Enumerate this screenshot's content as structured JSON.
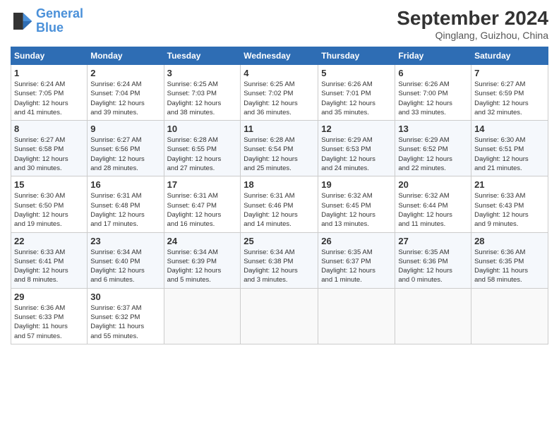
{
  "header": {
    "logo_line1": "General",
    "logo_line2": "Blue",
    "month_year": "September 2024",
    "location": "Qinglang, Guizhou, China"
  },
  "weekdays": [
    "Sunday",
    "Monday",
    "Tuesday",
    "Wednesday",
    "Thursday",
    "Friday",
    "Saturday"
  ],
  "weeks": [
    [
      {
        "day": "1",
        "info": "Sunrise: 6:24 AM\nSunset: 7:05 PM\nDaylight: 12 hours\nand 41 minutes."
      },
      {
        "day": "2",
        "info": "Sunrise: 6:24 AM\nSunset: 7:04 PM\nDaylight: 12 hours\nand 39 minutes."
      },
      {
        "day": "3",
        "info": "Sunrise: 6:25 AM\nSunset: 7:03 PM\nDaylight: 12 hours\nand 38 minutes."
      },
      {
        "day": "4",
        "info": "Sunrise: 6:25 AM\nSunset: 7:02 PM\nDaylight: 12 hours\nand 36 minutes."
      },
      {
        "day": "5",
        "info": "Sunrise: 6:26 AM\nSunset: 7:01 PM\nDaylight: 12 hours\nand 35 minutes."
      },
      {
        "day": "6",
        "info": "Sunrise: 6:26 AM\nSunset: 7:00 PM\nDaylight: 12 hours\nand 33 minutes."
      },
      {
        "day": "7",
        "info": "Sunrise: 6:27 AM\nSunset: 6:59 PM\nDaylight: 12 hours\nand 32 minutes."
      }
    ],
    [
      {
        "day": "8",
        "info": "Sunrise: 6:27 AM\nSunset: 6:58 PM\nDaylight: 12 hours\nand 30 minutes."
      },
      {
        "day": "9",
        "info": "Sunrise: 6:27 AM\nSunset: 6:56 PM\nDaylight: 12 hours\nand 28 minutes."
      },
      {
        "day": "10",
        "info": "Sunrise: 6:28 AM\nSunset: 6:55 PM\nDaylight: 12 hours\nand 27 minutes."
      },
      {
        "day": "11",
        "info": "Sunrise: 6:28 AM\nSunset: 6:54 PM\nDaylight: 12 hours\nand 25 minutes."
      },
      {
        "day": "12",
        "info": "Sunrise: 6:29 AM\nSunset: 6:53 PM\nDaylight: 12 hours\nand 24 minutes."
      },
      {
        "day": "13",
        "info": "Sunrise: 6:29 AM\nSunset: 6:52 PM\nDaylight: 12 hours\nand 22 minutes."
      },
      {
        "day": "14",
        "info": "Sunrise: 6:30 AM\nSunset: 6:51 PM\nDaylight: 12 hours\nand 21 minutes."
      }
    ],
    [
      {
        "day": "15",
        "info": "Sunrise: 6:30 AM\nSunset: 6:50 PM\nDaylight: 12 hours\nand 19 minutes."
      },
      {
        "day": "16",
        "info": "Sunrise: 6:31 AM\nSunset: 6:48 PM\nDaylight: 12 hours\nand 17 minutes."
      },
      {
        "day": "17",
        "info": "Sunrise: 6:31 AM\nSunset: 6:47 PM\nDaylight: 12 hours\nand 16 minutes."
      },
      {
        "day": "18",
        "info": "Sunrise: 6:31 AM\nSunset: 6:46 PM\nDaylight: 12 hours\nand 14 minutes."
      },
      {
        "day": "19",
        "info": "Sunrise: 6:32 AM\nSunset: 6:45 PM\nDaylight: 12 hours\nand 13 minutes."
      },
      {
        "day": "20",
        "info": "Sunrise: 6:32 AM\nSunset: 6:44 PM\nDaylight: 12 hours\nand 11 minutes."
      },
      {
        "day": "21",
        "info": "Sunrise: 6:33 AM\nSunset: 6:43 PM\nDaylight: 12 hours\nand 9 minutes."
      }
    ],
    [
      {
        "day": "22",
        "info": "Sunrise: 6:33 AM\nSunset: 6:41 PM\nDaylight: 12 hours\nand 8 minutes."
      },
      {
        "day": "23",
        "info": "Sunrise: 6:34 AM\nSunset: 6:40 PM\nDaylight: 12 hours\nand 6 minutes."
      },
      {
        "day": "24",
        "info": "Sunrise: 6:34 AM\nSunset: 6:39 PM\nDaylight: 12 hours\nand 5 minutes."
      },
      {
        "day": "25",
        "info": "Sunrise: 6:34 AM\nSunset: 6:38 PM\nDaylight: 12 hours\nand 3 minutes."
      },
      {
        "day": "26",
        "info": "Sunrise: 6:35 AM\nSunset: 6:37 PM\nDaylight: 12 hours\nand 1 minute."
      },
      {
        "day": "27",
        "info": "Sunrise: 6:35 AM\nSunset: 6:36 PM\nDaylight: 12 hours\nand 0 minutes."
      },
      {
        "day": "28",
        "info": "Sunrise: 6:36 AM\nSunset: 6:35 PM\nDaylight: 11 hours\nand 58 minutes."
      }
    ],
    [
      {
        "day": "29",
        "info": "Sunrise: 6:36 AM\nSunset: 6:33 PM\nDaylight: 11 hours\nand 57 minutes."
      },
      {
        "day": "30",
        "info": "Sunrise: 6:37 AM\nSunset: 6:32 PM\nDaylight: 11 hours\nand 55 minutes."
      },
      null,
      null,
      null,
      null,
      null
    ]
  ]
}
